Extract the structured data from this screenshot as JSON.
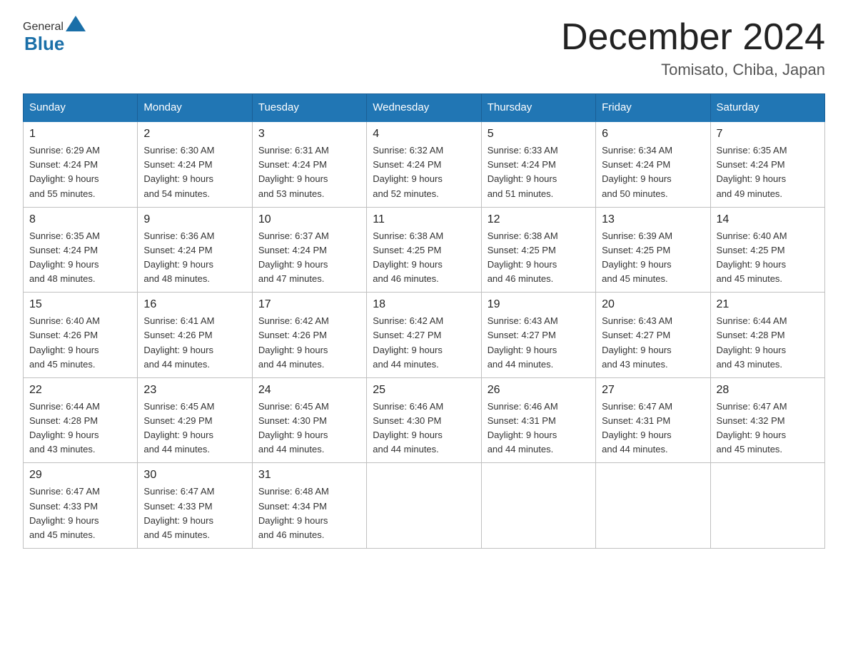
{
  "header": {
    "logo_general": "General",
    "logo_blue": "Blue",
    "month_title": "December 2024",
    "location": "Tomisato, Chiba, Japan"
  },
  "weekdays": [
    "Sunday",
    "Monday",
    "Tuesday",
    "Wednesday",
    "Thursday",
    "Friday",
    "Saturday"
  ],
  "weeks": [
    [
      {
        "day": "1",
        "info": "Sunrise: 6:29 AM\nSunset: 4:24 PM\nDaylight: 9 hours\nand 55 minutes."
      },
      {
        "day": "2",
        "info": "Sunrise: 6:30 AM\nSunset: 4:24 PM\nDaylight: 9 hours\nand 54 minutes."
      },
      {
        "day": "3",
        "info": "Sunrise: 6:31 AM\nSunset: 4:24 PM\nDaylight: 9 hours\nand 53 minutes."
      },
      {
        "day": "4",
        "info": "Sunrise: 6:32 AM\nSunset: 4:24 PM\nDaylight: 9 hours\nand 52 minutes."
      },
      {
        "day": "5",
        "info": "Sunrise: 6:33 AM\nSunset: 4:24 PM\nDaylight: 9 hours\nand 51 minutes."
      },
      {
        "day": "6",
        "info": "Sunrise: 6:34 AM\nSunset: 4:24 PM\nDaylight: 9 hours\nand 50 minutes."
      },
      {
        "day": "7",
        "info": "Sunrise: 6:35 AM\nSunset: 4:24 PM\nDaylight: 9 hours\nand 49 minutes."
      }
    ],
    [
      {
        "day": "8",
        "info": "Sunrise: 6:35 AM\nSunset: 4:24 PM\nDaylight: 9 hours\nand 48 minutes."
      },
      {
        "day": "9",
        "info": "Sunrise: 6:36 AM\nSunset: 4:24 PM\nDaylight: 9 hours\nand 48 minutes."
      },
      {
        "day": "10",
        "info": "Sunrise: 6:37 AM\nSunset: 4:24 PM\nDaylight: 9 hours\nand 47 minutes."
      },
      {
        "day": "11",
        "info": "Sunrise: 6:38 AM\nSunset: 4:25 PM\nDaylight: 9 hours\nand 46 minutes."
      },
      {
        "day": "12",
        "info": "Sunrise: 6:38 AM\nSunset: 4:25 PM\nDaylight: 9 hours\nand 46 minutes."
      },
      {
        "day": "13",
        "info": "Sunrise: 6:39 AM\nSunset: 4:25 PM\nDaylight: 9 hours\nand 45 minutes."
      },
      {
        "day": "14",
        "info": "Sunrise: 6:40 AM\nSunset: 4:25 PM\nDaylight: 9 hours\nand 45 minutes."
      }
    ],
    [
      {
        "day": "15",
        "info": "Sunrise: 6:40 AM\nSunset: 4:26 PM\nDaylight: 9 hours\nand 45 minutes."
      },
      {
        "day": "16",
        "info": "Sunrise: 6:41 AM\nSunset: 4:26 PM\nDaylight: 9 hours\nand 44 minutes."
      },
      {
        "day": "17",
        "info": "Sunrise: 6:42 AM\nSunset: 4:26 PM\nDaylight: 9 hours\nand 44 minutes."
      },
      {
        "day": "18",
        "info": "Sunrise: 6:42 AM\nSunset: 4:27 PM\nDaylight: 9 hours\nand 44 minutes."
      },
      {
        "day": "19",
        "info": "Sunrise: 6:43 AM\nSunset: 4:27 PM\nDaylight: 9 hours\nand 44 minutes."
      },
      {
        "day": "20",
        "info": "Sunrise: 6:43 AM\nSunset: 4:27 PM\nDaylight: 9 hours\nand 43 minutes."
      },
      {
        "day": "21",
        "info": "Sunrise: 6:44 AM\nSunset: 4:28 PM\nDaylight: 9 hours\nand 43 minutes."
      }
    ],
    [
      {
        "day": "22",
        "info": "Sunrise: 6:44 AM\nSunset: 4:28 PM\nDaylight: 9 hours\nand 43 minutes."
      },
      {
        "day": "23",
        "info": "Sunrise: 6:45 AM\nSunset: 4:29 PM\nDaylight: 9 hours\nand 44 minutes."
      },
      {
        "day": "24",
        "info": "Sunrise: 6:45 AM\nSunset: 4:30 PM\nDaylight: 9 hours\nand 44 minutes."
      },
      {
        "day": "25",
        "info": "Sunrise: 6:46 AM\nSunset: 4:30 PM\nDaylight: 9 hours\nand 44 minutes."
      },
      {
        "day": "26",
        "info": "Sunrise: 6:46 AM\nSunset: 4:31 PM\nDaylight: 9 hours\nand 44 minutes."
      },
      {
        "day": "27",
        "info": "Sunrise: 6:47 AM\nSunset: 4:31 PM\nDaylight: 9 hours\nand 44 minutes."
      },
      {
        "day": "28",
        "info": "Sunrise: 6:47 AM\nSunset: 4:32 PM\nDaylight: 9 hours\nand 45 minutes."
      }
    ],
    [
      {
        "day": "29",
        "info": "Sunrise: 6:47 AM\nSunset: 4:33 PM\nDaylight: 9 hours\nand 45 minutes."
      },
      {
        "day": "30",
        "info": "Sunrise: 6:47 AM\nSunset: 4:33 PM\nDaylight: 9 hours\nand 45 minutes."
      },
      {
        "day": "31",
        "info": "Sunrise: 6:48 AM\nSunset: 4:34 PM\nDaylight: 9 hours\nand 46 minutes."
      },
      {
        "day": "",
        "info": ""
      },
      {
        "day": "",
        "info": ""
      },
      {
        "day": "",
        "info": ""
      },
      {
        "day": "",
        "info": ""
      }
    ]
  ]
}
